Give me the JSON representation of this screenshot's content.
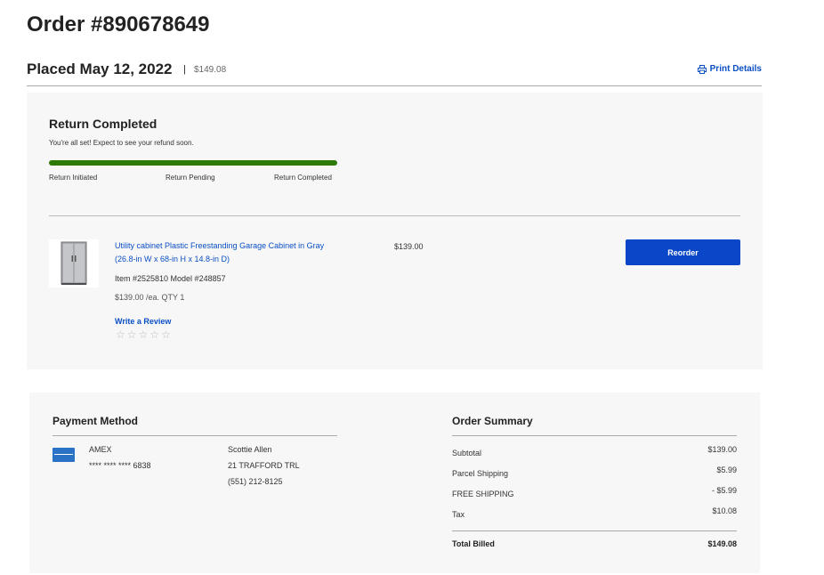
{
  "order": {
    "title": "Order #890678649"
  },
  "placed": {
    "date": "Placed May 12, 2022",
    "separator": "|",
    "total": "$149.08",
    "print_label": "Print Details"
  },
  "return_status": {
    "title": "Return Completed",
    "subtitle": "You're all set! Expect to see your refund soon.",
    "progress_fraction": 1.0,
    "progress_color": "#2d7a07",
    "steps": [
      "Return Initiated",
      "Return Pending",
      "Return Completed"
    ]
  },
  "item": {
    "name": "Utility cabinet Plastic Freestanding Garage Cabinet in Gray (26.8-in W x 68-in H x 14.8-in D)",
    "meta": "Item #2525810 Model #248857",
    "unit_price_qty": "$139.00 /ea. QTY 1",
    "review_label": "Write a Review",
    "rating_stars": 0,
    "price": "$139.00",
    "reorder_label": "Reorder"
  },
  "payment": {
    "title": "Payment Method",
    "card_icon": "amex-card-icon",
    "card_brand": "AMEX",
    "card_number": "**** **** **** 6838",
    "address_name": "Scottie Allen",
    "address_street": "21 TRAFFORD TRL",
    "address_phone": "(551) 212-8125"
  },
  "summary": {
    "title": "Order Summary",
    "rows": [
      {
        "label": "Subtotal",
        "value": "$139.00"
      },
      {
        "label": "Parcel Shipping",
        "value": "$5.99"
      },
      {
        "label": "FREE SHIPPING",
        "value": "- $5.99"
      },
      {
        "label": "Tax",
        "value": "$10.08"
      }
    ],
    "total_label": "Total Billed",
    "total_value": "$149.08"
  },
  "colors": {
    "link": "#0a4fc4",
    "button": "#0a46c8",
    "panel": "#f7f7f7"
  }
}
